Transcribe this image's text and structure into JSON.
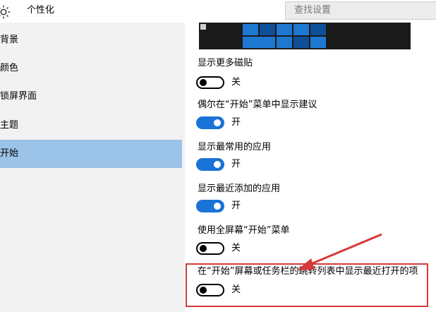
{
  "header": {
    "app_title": "个性化",
    "search_placeholder": "查找设置"
  },
  "sidebar": {
    "items": [
      {
        "label": "背景"
      },
      {
        "label": "颜色"
      },
      {
        "label": "锁屏界面"
      },
      {
        "label": "主题"
      },
      {
        "label": "开始"
      }
    ],
    "active_index": 4
  },
  "settings": [
    {
      "label": "显示更多磁贴",
      "state": "关",
      "on": false
    },
    {
      "label": "偶尔在“开始”菜单中显示建议",
      "state": "开",
      "on": true
    },
    {
      "label": "显示最常用的应用",
      "state": "开",
      "on": true
    },
    {
      "label": "显示最近添加的应用",
      "state": "开",
      "on": true
    },
    {
      "label": "使用全屏幕“开始”菜单",
      "state": "关",
      "on": false
    },
    {
      "label": "在“开始”屏幕或任务栏的跳转列表中显示最近打开的项",
      "state": "关",
      "on": false
    }
  ],
  "colors": {
    "accent": "#1a73d6",
    "sidebar_active": "#9cc3e8",
    "highlight": "#d33a3a"
  }
}
